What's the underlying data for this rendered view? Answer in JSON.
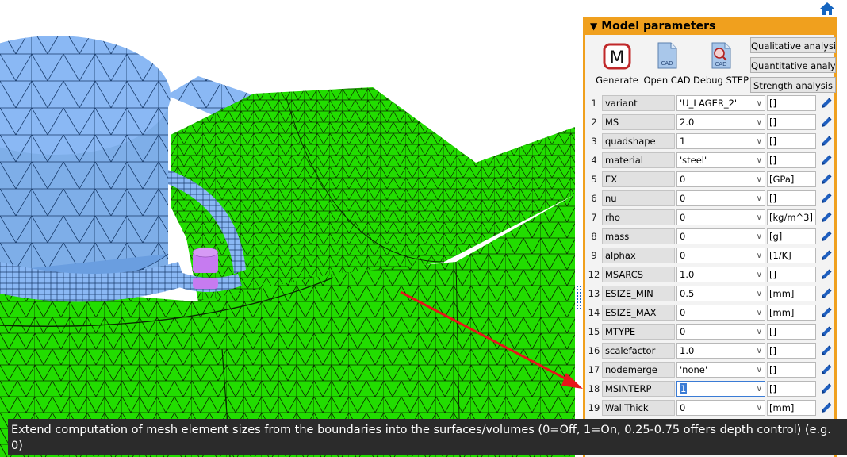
{
  "panel": {
    "title": "Model parameters",
    "tools": [
      {
        "label": "Generate",
        "icon": "generate-m-icon"
      },
      {
        "label": "Open CAD",
        "icon": "cad-file-icon"
      },
      {
        "label": "Debug STEP",
        "icon": "cad-debug-icon"
      }
    ],
    "analysis_buttons": [
      "Qualitative analysis",
      "Quantitative analysis",
      "Strength analysis"
    ],
    "params": [
      {
        "idx": "1",
        "name": "variant",
        "value": "'U_LAGER_2'",
        "unit": "[]"
      },
      {
        "idx": "2",
        "name": "MS",
        "value": "2.0",
        "unit": "[]"
      },
      {
        "idx": "3",
        "name": "quadshape",
        "value": "1",
        "unit": "[]"
      },
      {
        "idx": "4",
        "name": "material",
        "value": "'steel'",
        "unit": "[]"
      },
      {
        "idx": "5",
        "name": "EX",
        "value": "0",
        "unit": "[GPa]"
      },
      {
        "idx": "6",
        "name": "nu",
        "value": "0",
        "unit": "[]"
      },
      {
        "idx": "7",
        "name": "rho",
        "value": "0",
        "unit": "[kg/m^3]"
      },
      {
        "idx": "8",
        "name": "mass",
        "value": "0",
        "unit": "[g]"
      },
      {
        "idx": "9",
        "name": "alphax",
        "value": "0",
        "unit": "[1/K]"
      },
      {
        "idx": "12",
        "name": "MSARCS",
        "value": "1.0",
        "unit": "[]"
      },
      {
        "idx": "13",
        "name": "ESIZE_MIN",
        "value": "0.5",
        "unit": "[mm]"
      },
      {
        "idx": "14",
        "name": "ESIZE_MAX",
        "value": "0",
        "unit": "[mm]"
      },
      {
        "idx": "15",
        "name": "MTYPE",
        "value": "0",
        "unit": "[]"
      },
      {
        "idx": "16",
        "name": "scalefactor",
        "value": "1.0",
        "unit": "[]"
      },
      {
        "idx": "17",
        "name": "nodemerge",
        "value": "'none'",
        "unit": "[]"
      },
      {
        "idx": "18",
        "name": "MSINTERP",
        "value": "1",
        "unit": "[]"
      },
      {
        "idx": "19",
        "name": "WallThick",
        "value": "0",
        "unit": "[mm]"
      }
    ],
    "selected_param_index": 15
  },
  "tooltip": "Extend computation of mesh element sizes from the boundaries into the surfaces/volumes (0=Off, 1=On, 0.25-0.75 offers depth control) (e.g. 0)",
  "colors": {
    "accent": "#f0a01e",
    "mesh_green": "#22dd00",
    "mesh_blue": "#8ab8f4",
    "mesh_purple": "#c67bf0",
    "arrow": "#e8141a",
    "selection": "#3a7bd5"
  },
  "icons": {
    "home": "home-icon",
    "edit": "pencil-edit-icon",
    "dropdown": "chevron-down-icon"
  }
}
